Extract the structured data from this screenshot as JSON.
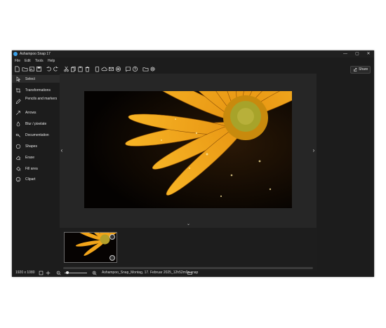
{
  "window": {
    "title": "Ashampoo Snap 17"
  },
  "window_controls": {
    "minimize": "—",
    "maximize": "▢",
    "close": "✕"
  },
  "menu": [
    "File",
    "Edit",
    "Tools",
    "Help"
  ],
  "toolbar": {
    "share_label": "Share"
  },
  "sidebar": {
    "items": [
      {
        "label": "Select",
        "icon": "cursor-icon"
      },
      {
        "label": "Transformations",
        "icon": "crop-icon"
      },
      {
        "label": "Pencils and markers",
        "icon": "pencil-icon"
      },
      {
        "label": "Arrows",
        "icon": "arrow-icon"
      },
      {
        "label": "Blur / pixelate",
        "icon": "drop-icon"
      },
      {
        "label": "Documentation",
        "icon": "documentation-icon"
      },
      {
        "label": "Shapes",
        "icon": "shapes-icon"
      },
      {
        "label": "Erase",
        "icon": "eraser-icon"
      },
      {
        "label": "Fill area",
        "icon": "fill-icon"
      },
      {
        "label": "Clipart",
        "icon": "smiley-icon"
      }
    ]
  },
  "canvas": {
    "prev": "‹",
    "next": "›",
    "collapse": "⌄"
  },
  "status": {
    "dimensions": "1920 x 1080",
    "filename": "Ashampoo_Snap_Montag, 17. Februar 2025_12h52m0s.snap"
  },
  "colors": {
    "accent": "#f2a51a",
    "background": "#1c1c1c",
    "canvas": "#262626"
  }
}
